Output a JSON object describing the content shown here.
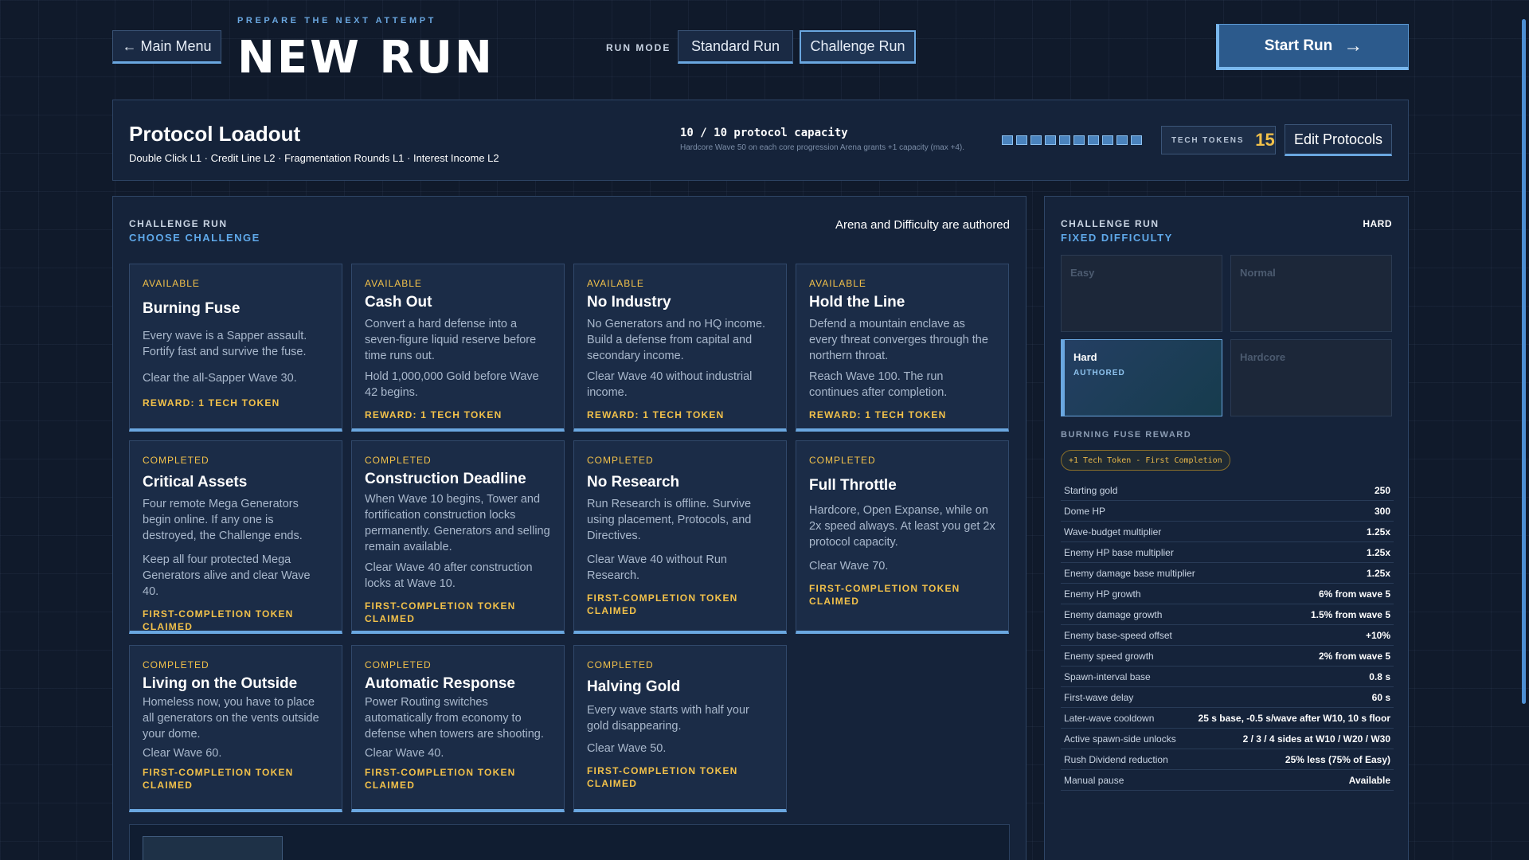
{
  "header": {
    "back_label": "← Main Menu",
    "eyebrow": "PREPARE THE NEXT ATTEMPT",
    "title": "NEW RUN",
    "run_mode_label": "RUN MODE",
    "modes": [
      "Standard Run",
      "Challenge Run"
    ],
    "selected_mode": "Challenge Run",
    "start_label": "Start Run",
    "start_arrow": "→"
  },
  "loadout": {
    "title": "Protocol Loadout",
    "protocols": "Double Click L1 · Credit Line L2 · Fragmentation Rounds L1 · Interest Income L2",
    "capacity": "10 / 10 protocol capacity",
    "capacity_note": "Hardcore Wave 50 on each core progression Arena grants +1 capacity (max +4).",
    "capacity_used": 10,
    "capacity_total": 10,
    "tokens_label": "TECH TOKENS",
    "tokens_value": "15",
    "edit_label": "Edit Protocols"
  },
  "challenges": {
    "kicker": "CHALLENGE RUN",
    "subtitle": "CHOOSE CHALLENGE",
    "authored_note": "Arena and Difficulty are authored",
    "cards": [
      {
        "status": "AVAILABLE",
        "title": "Burning Fuse",
        "desc": "Every wave is a Sapper assault. Fortify fast and survive the fuse.",
        "goal": "Clear the all-Sapper Wave 30.",
        "reward": "REWARD: 1 TECH TOKEN"
      },
      {
        "status": "AVAILABLE",
        "title": "Cash Out",
        "desc": "Convert a hard defense into a seven-figure liquid reserve before time runs out.",
        "goal": "Hold 1,000,000 Gold before Wave 42 begins.",
        "reward": "REWARD: 1 TECH TOKEN"
      },
      {
        "status": "AVAILABLE",
        "title": "No Industry",
        "desc": "No Generators and no HQ income. Build a defense from capital and secondary income.",
        "goal": "Clear Wave 40 without industrial income.",
        "reward": "REWARD: 1 TECH TOKEN"
      },
      {
        "status": "AVAILABLE",
        "title": "Hold the Line",
        "desc": "Defend a mountain enclave as every threat converges through the northern throat.",
        "goal": "Reach Wave 100. The run continues after completion.",
        "reward": "REWARD: 1 TECH TOKEN"
      },
      {
        "status": "COMPLETED",
        "title": "Critical Assets",
        "desc": "Four remote Mega Generators begin online. If any one is destroyed, the Challenge ends.",
        "goal": "Keep all four protected Mega Generators alive and clear Wave 40.",
        "reward": "FIRST-COMPLETION TOKEN CLAIMED"
      },
      {
        "status": "COMPLETED",
        "title": "Construction Deadline",
        "desc": "When Wave 10 begins, Tower and fortification construction locks permanently. Generators and selling remain available.",
        "goal": "Clear Wave 40 after construction locks at Wave 10.",
        "reward": "FIRST-COMPLETION TOKEN CLAIMED"
      },
      {
        "status": "COMPLETED",
        "title": "No Research",
        "desc": "Run Research is offline. Survive using placement, Protocols, and Directives.",
        "goal": "Clear Wave 40 without Run Research.",
        "reward": "FIRST-COMPLETION TOKEN CLAIMED"
      },
      {
        "status": "COMPLETED",
        "title": "Full Throttle",
        "desc": "Hardcore, Open Expanse, while on 2x speed always. At least you get 2x protocol capacity.",
        "goal": "Clear Wave 70.",
        "reward": "FIRST-COMPLETION TOKEN CLAIMED"
      },
      {
        "status": "COMPLETED",
        "title": "Living on the Outside",
        "desc": "Homeless now, you have to place all generators on the vents outside your dome.",
        "goal": "Clear Wave 60.",
        "reward": "FIRST-COMPLETION TOKEN CLAIMED"
      },
      {
        "status": "COMPLETED",
        "title": "Automatic Response",
        "desc": "Power Routing switches automatically from economy to defense when towers are shooting.",
        "goal": "Clear Wave 40.",
        "reward": "FIRST-COMPLETION TOKEN CLAIMED"
      },
      {
        "status": "COMPLETED",
        "title": "Halving Gold",
        "desc": "Every wave starts with half your gold disappearing.",
        "goal": "Clear Wave 50.",
        "reward": "FIRST-COMPLETION TOKEN CLAIMED"
      }
    ]
  },
  "side": {
    "kicker": "CHALLENGE RUN",
    "subtitle": "FIXED DIFFICULTY",
    "level": "HARD",
    "difficulties": [
      {
        "name": "Easy",
        "sub": ""
      },
      {
        "name": "Normal",
        "sub": ""
      },
      {
        "name": "Hard",
        "sub": "AUTHORED"
      },
      {
        "name": "Hardcore",
        "sub": ""
      }
    ],
    "selected_difficulty": "Hard",
    "reward_head": "BURNING FUSE REWARD",
    "reward_pill": "+1 Tech Token - First Completion",
    "stats": [
      {
        "label": "Starting gold",
        "value": "250"
      },
      {
        "label": "Dome HP",
        "value": "300"
      },
      {
        "label": "Wave-budget multiplier",
        "value": "1.25x"
      },
      {
        "label": "Enemy HP base multiplier",
        "value": "1.25x"
      },
      {
        "label": "Enemy damage base multiplier",
        "value": "1.25x"
      },
      {
        "label": "Enemy HP growth",
        "value": "6% from wave 5"
      },
      {
        "label": "Enemy damage growth",
        "value": "1.5% from wave 5"
      },
      {
        "label": "Enemy base-speed offset",
        "value": "+10%"
      },
      {
        "label": "Enemy speed growth",
        "value": "2% from wave 5"
      },
      {
        "label": "Spawn-interval base",
        "value": "0.8 s"
      },
      {
        "label": "First-wave delay",
        "value": "60 s"
      },
      {
        "label": "Later-wave cooldown",
        "value": "25 s base, -0.5 s/wave after W10, 10 s floor"
      },
      {
        "label": "Active spawn-side unlocks",
        "value": "2 / 3 / 4 sides at W10 / W20 / W30"
      },
      {
        "label": "Rush Dividend reduction",
        "value": "25% less (75% of Easy)"
      },
      {
        "label": "Manual pause",
        "value": "Available"
      }
    ]
  },
  "colors": {
    "accent": "#6aa7e0",
    "gold": "#f2c14a",
    "background": "#101a2b",
    "panel": "#15233a"
  }
}
